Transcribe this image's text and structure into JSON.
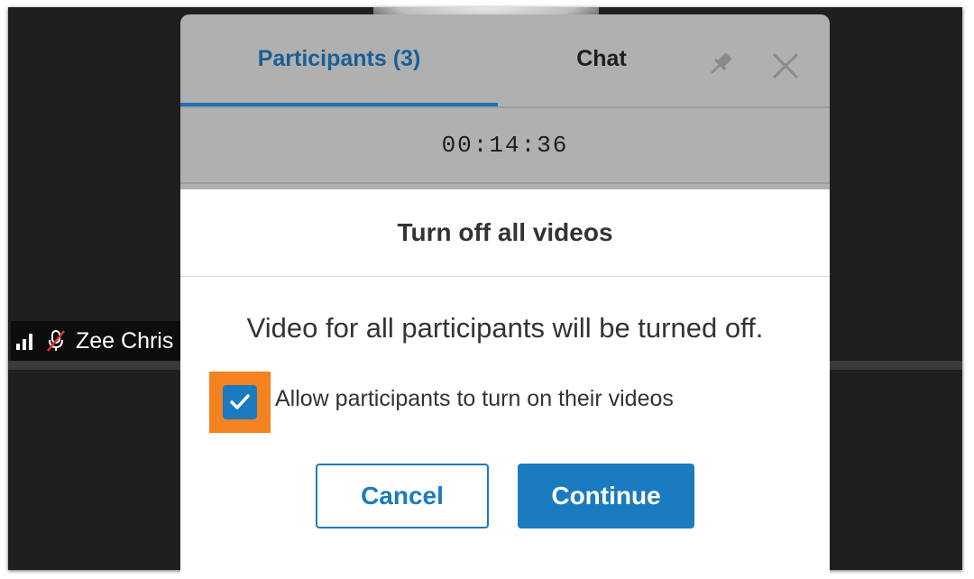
{
  "background": {
    "participant_name": "Zee Chris"
  },
  "panel": {
    "tabs": [
      {
        "label": "Participants (3)",
        "active": true
      },
      {
        "label": "Chat",
        "active": false
      }
    ],
    "timer": "00:14:36",
    "icons": [
      "pin-icon",
      "close-icon"
    ]
  },
  "modal": {
    "title": "Turn off all videos",
    "message": "Video for all participants will be turned off.",
    "checkbox_label": "Allow participants to turn on their videos",
    "checkbox_checked": true,
    "cancel_label": "Cancel",
    "continue_label": "Continue"
  },
  "colors": {
    "accent": "#1b7bc0",
    "highlight": "#f58220",
    "panel_gray": "#b0b0b0"
  }
}
